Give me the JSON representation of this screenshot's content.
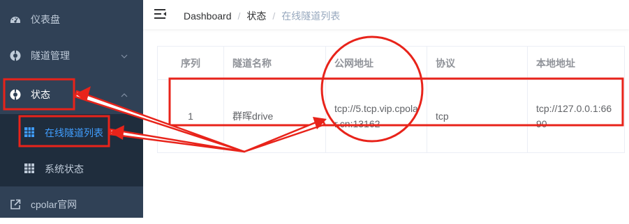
{
  "sidebar": {
    "items": [
      {
        "label": "仪表盘",
        "icon": "dashboard-icon"
      },
      {
        "label": "隧道管理",
        "icon": "tunnel-icon"
      },
      {
        "label": "状态",
        "icon": "status-icon"
      },
      {
        "label": "cpolar官网",
        "icon": "external-link-icon"
      }
    ],
    "sub_items": [
      {
        "label": "在线隧道列表",
        "icon": "grid-icon"
      },
      {
        "label": "系统状态",
        "icon": "grid-icon"
      }
    ]
  },
  "header": {
    "breadcrumb": [
      "Dashboard",
      "状态",
      "在线隧道列表"
    ],
    "separator": "/"
  },
  "table": {
    "columns": [
      "序列",
      "隧道名称",
      "公网地址",
      "协议",
      "本地地址"
    ],
    "rows": [
      [
        "1",
        "群晖drive",
        "tcp://5.tcp.vip.cpolar.cn:13162",
        "tcp",
        "tcp://127.0.0.1:6690"
      ]
    ]
  },
  "colors": {
    "sidebar_bg": "#304156",
    "submenu_bg": "#1f2d3d",
    "active": "#409eff",
    "annotation": "#e8231a"
  }
}
